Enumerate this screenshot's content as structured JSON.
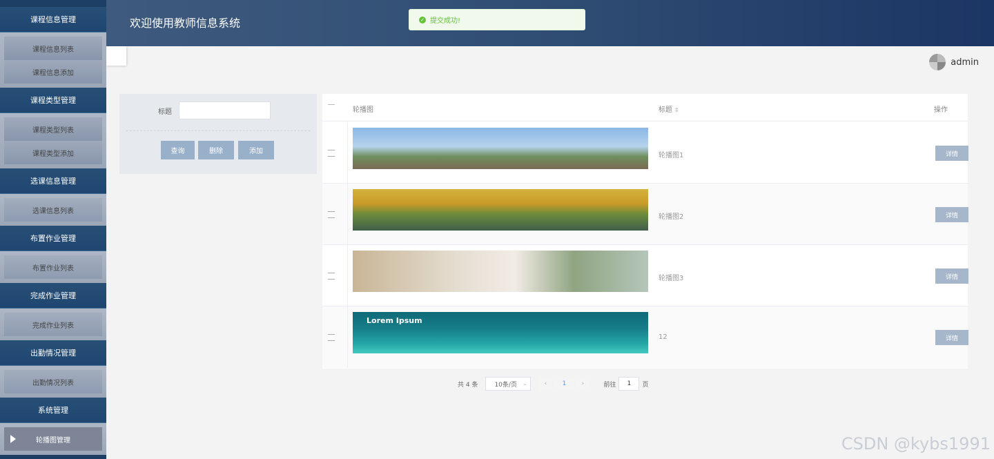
{
  "header": {
    "title": "欢迎使用教师信息系统"
  },
  "toast": {
    "message": "提交成功!"
  },
  "user": {
    "name": "admin"
  },
  "sidebar": {
    "groups": [
      {
        "header": "课程信息管理",
        "items": [
          "课程信息列表",
          "课程信息添加"
        ]
      },
      {
        "header": "课程类型管理",
        "items": [
          "课程类型列表",
          "课程类型添加"
        ]
      },
      {
        "header": "选课信息管理",
        "items": [
          "选课信息列表"
        ]
      },
      {
        "header": "布置作业管理",
        "items": [
          "布置作业列表"
        ]
      },
      {
        "header": "完成作业管理",
        "items": [
          "完成作业列表"
        ]
      },
      {
        "header": "出勤情况管理",
        "items": [
          "出勤情况列表"
        ]
      },
      {
        "header": "系统管理",
        "items": [
          "轮播图管理"
        ]
      }
    ]
  },
  "search": {
    "label": "标题",
    "value": "",
    "query_label": "查询",
    "delete_label": "删除",
    "add_label": "添加"
  },
  "table": {
    "columns": [
      "轮播图",
      "标题",
      "操作"
    ],
    "rows": [
      {
        "title": "轮播图1",
        "action": "详情",
        "banner_text": ""
      },
      {
        "title": "轮播图2",
        "action": "详情",
        "banner_text": ""
      },
      {
        "title": "轮播图3",
        "action": "详情",
        "banner_text": ""
      },
      {
        "title": "12",
        "action": "详情",
        "banner_text": "Lorem Ipsum"
      }
    ]
  },
  "pagination": {
    "total_label": "共 4 条",
    "page_size": "10条/页",
    "current_page": "1",
    "prev": "‹",
    "next": "›",
    "goto_label": "前往",
    "goto_value": "1",
    "page_suffix": "页"
  },
  "watermark": "CSDN @kybs1991"
}
